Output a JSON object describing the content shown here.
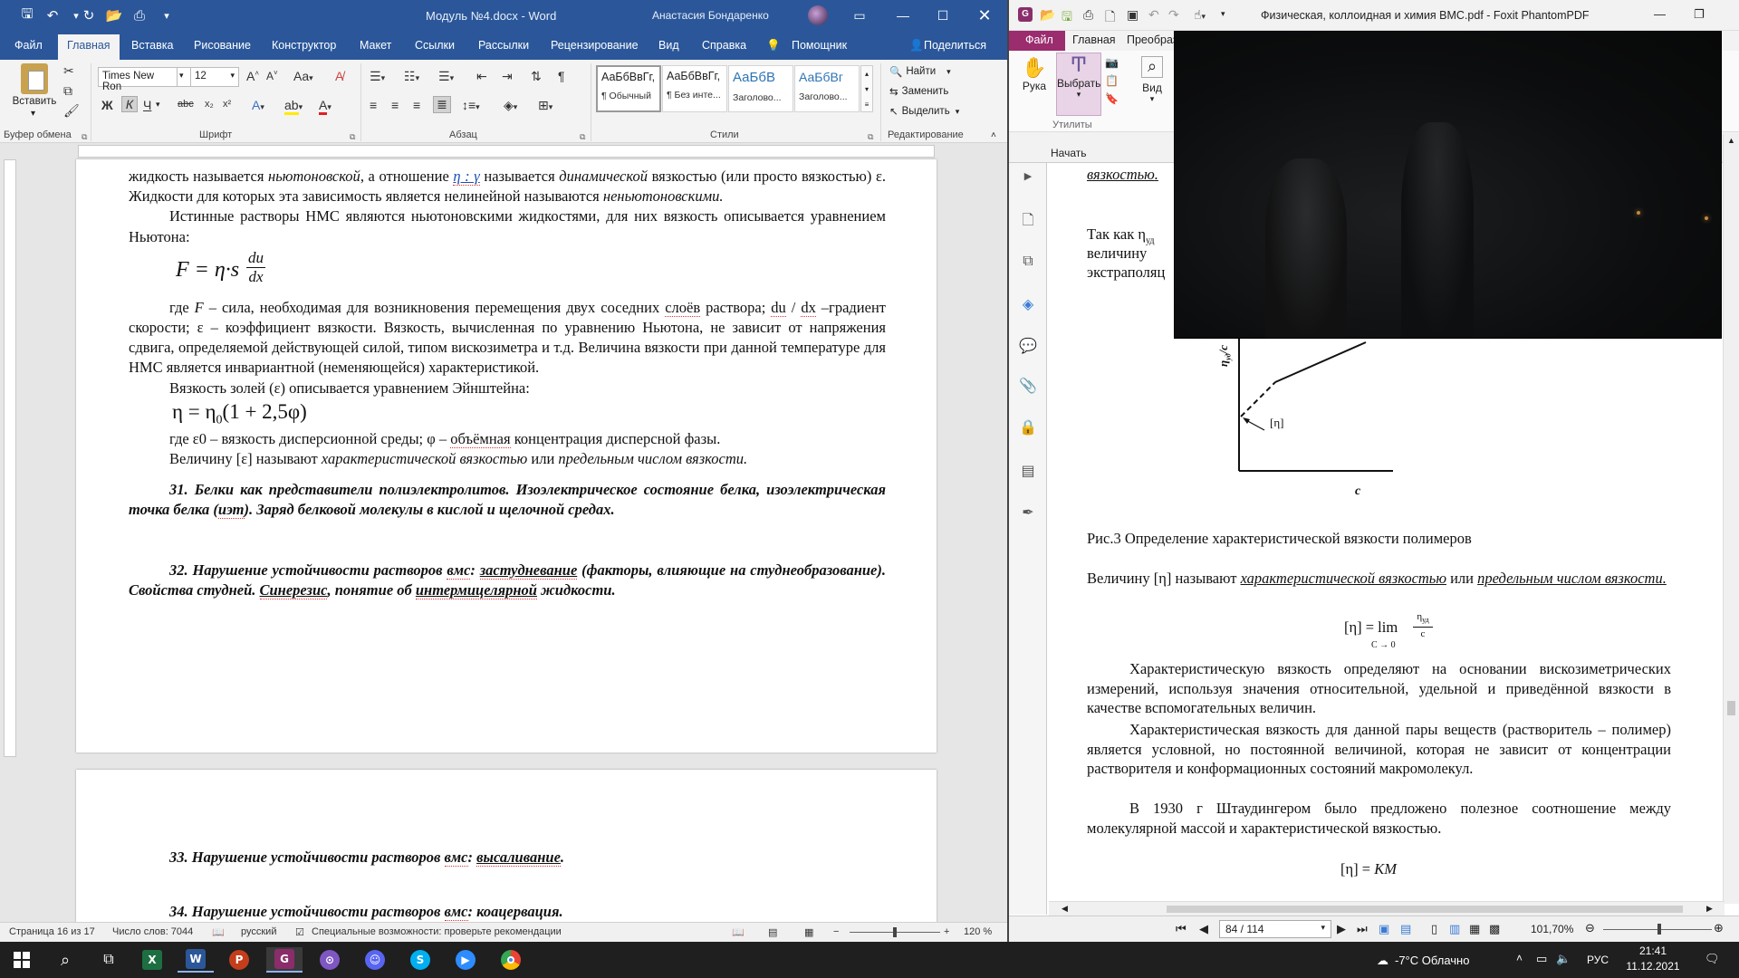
{
  "word": {
    "title": "Модуль №4.docx  -  Word",
    "user": "Анастасия Бондаренко",
    "tabs": [
      "Файл",
      "Главная",
      "Вставка",
      "Рисование",
      "Конструктор",
      "Макет",
      "Ссылки",
      "Рассылки",
      "Рецензирование",
      "Вид",
      "Справка",
      "Помощник",
      "Поделиться"
    ],
    "ribbon": {
      "paste": "Вставить",
      "clipboard_group": "Буфер обмена",
      "font_name": "Times New Ron",
      "font_size": "12",
      "font_group": "Шрифт",
      "paragraph_group": "Абзац",
      "styles": [
        {
          "preview": "АаБбВвГг,",
          "name": "¶ Обычный"
        },
        {
          "preview": "АаБбВвГг,",
          "name": "¶ Без инте..."
        },
        {
          "preview": "АаБбВ",
          "name": "Заголово..."
        },
        {
          "preview": "АаБбВг",
          "name": "Заголово..."
        }
      ],
      "styles_group": "Стили",
      "find": "Найти",
      "replace": "Заменить",
      "select": "Выделить",
      "editing_group": "Редактирование"
    },
    "doc": {
      "p1_a": "жидкость называется ",
      "p1_b": "ньютоновской",
      "p1_c": ", а отношение ",
      "p1_d": "η : γ",
      "p1_e": " называется  ",
      "p1_f": "динамической",
      "p1_g": " вязкостью (или просто вязкостью) ε. Жидкости для которых эта зависимость является нелинейной называются ",
      "p1_h": "неньютоновскими.",
      "p2": "Истинные растворы НМС являются ньютоновскими жидкостями, для них вязкость описывается уравнением Ньютона:",
      "eq1": "F = η·s",
      "eq1_num": "du",
      "eq1_den": "dx",
      "p3_a": "где ",
      "p3_b": "F",
      "p3_c": " – сила, необходимая для возникновения перемещения двух соседних ",
      "p3_d": "слоёв",
      "p3_e": " раствора; ",
      "p3_f": "du",
      "p3_g": " / ",
      "p3_h": "dx",
      "p3_i": " –градиент скорости; ε – коэффициент вязкости. Вязкость, вычисленная по уравнению Ньютона, не зависит от напряжения сдвига, определяемой действующей силой, типом вискозиметра и т.д. Величина вязкости при данной температуре для НМС является инвариантной (неменяющейся) характеристикой.",
      "p4": "Вязкость золей (ε) описывается уравнением Эйнштейна:",
      "eq2": "η = η",
      "eq2_sub": "0",
      "eq2_rest": "(1 + 2,5φ)",
      "p5_a": "где ε0 – вязкость дисперсионной среды; φ – ",
      "p5_b": "объёмная",
      "p5_c": " концентрация дисперсной фазы.",
      "p6_a": "Величину [ε] называют ",
      "p6_b": "характеристической вязкостью",
      "p6_c": " или ",
      "p6_d": "предельным числом вязкости.",
      "h31_a": "31. Белки как представители полиэлектролитов. Изоэлектрическое состояние белка, изоэлектрическая точка белка (",
      "h31_b": "иэт",
      "h31_c": "). Заряд белковой молекулы в кислой и щелочной средах.",
      "h32_a": "32. Нарушение устойчивости растворов ",
      "h32_b": "вмс",
      "h32_c": ": ",
      "h32_d": "застудневание",
      "h32_e": " (факторы, влияющие на студнеобразование). Свойства студней. ",
      "h32_f": "Синерезис",
      "h32_g": ", понятие об ",
      "h32_h": "интермицелярной",
      "h32_i": " жидкости.",
      "h33_a": "33. Нарушение устойчивости растворов ",
      "h33_b": "вмс",
      "h33_c": ": ",
      "h33_d": "высаливание",
      "h33_e": ".",
      "h34_a": "34. Нарушение устойчивости растворов ",
      "h34_b": "вмс",
      "h34_c": ": коацервация."
    },
    "status": {
      "page": "Страница 16 из 17",
      "words": "Число слов: 7044",
      "lang": "русский",
      "accessibility": "Специальные возможности: проверьте рекомендации",
      "zoom": "120 %"
    }
  },
  "foxit": {
    "title": "Физическая, коллоидная и химия ВМС.pdf - Foxit PhantomPDF",
    "tabs": [
      "Файл",
      "Главная",
      "Преобраз"
    ],
    "tools": {
      "hand": "Рука",
      "select": "Выбрать",
      "view": "Вид",
      "group": "Утилиты"
    },
    "nav_tab": "Начать",
    "pdf": {
      "top_frag": "вязкостью",
      "so_a": "Так как η",
      "so_sub": "уд",
      "l2": "величину",
      "l3": "экстраполяц",
      "axis_y": "η",
      "axis_y_sub": "уд",
      "axis_y_den": "c",
      "axis_x": "c",
      "eta_label": "[η]",
      "caption": "Рис.3 Определение характеристической вязкости полимеров",
      "p1_a": "Величину [η] называют ",
      "p1_b": "характеристической вязкостью",
      "p1_c": " или ",
      "p1_d": "предельным числом вязкости.",
      "eq_lhs": "[η] = lim",
      "eq_lim": "C → 0",
      "eq_num": "η",
      "eq_num_sub": "уд",
      "eq_den": "c",
      "p2": "Характеристическую вязкость определяют на основании вискозиметрических измерений, используя значения относительной, удельной и приведённой вязкости в качестве вспомогательных величин.",
      "p3": "Характеристическая вязкость для данной пары веществ (растворитель – полимер) является условной, но постоянной величиной, которая не зависит от концентрации растворителя и конформационных состояний макромолекул.",
      "p4": "В 1930 г Штаудингером было предложено полезное соотношение между молекулярной массой и характеристической вязкостью.",
      "eq3_a": "[η] = ",
      "eq3_b": "KM"
    },
    "status": {
      "page": "84 / 114",
      "zoom": "101,70%"
    }
  },
  "taskbar": {
    "weather": "-7°C  Облачно",
    "lang": "РУС",
    "time": "21:41",
    "date": "11.12.2021"
  }
}
